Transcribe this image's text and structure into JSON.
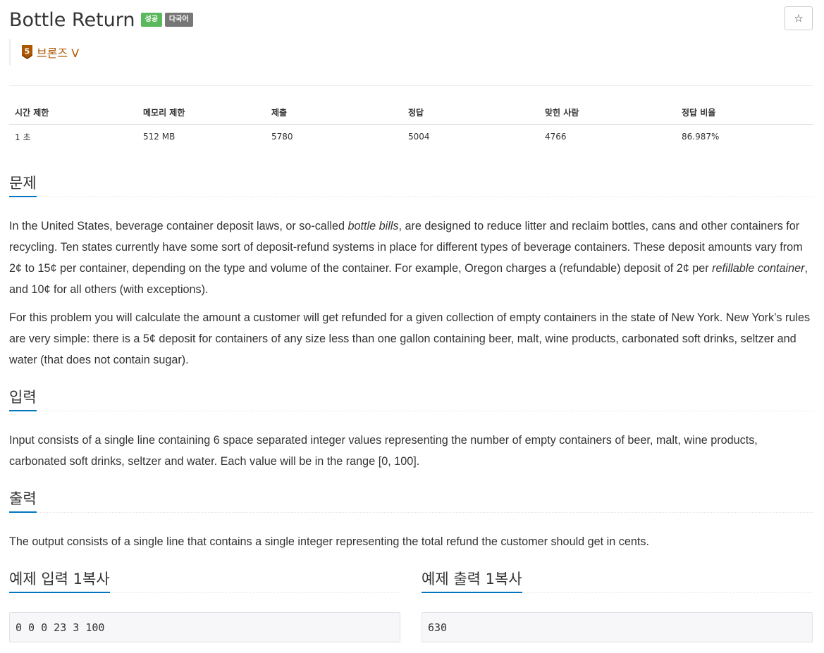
{
  "problem": {
    "title": "Bottle Return",
    "badges": {
      "success": "성공",
      "multilang": "다국어"
    },
    "star_icon": "☆",
    "tier": {
      "level": "5",
      "label": "브론즈 V",
      "color": "#ad5600"
    }
  },
  "stats": {
    "headers": [
      "시간 제한",
      "메모리 제한",
      "제출",
      "정답",
      "맞힌 사람",
      "정답 비율"
    ],
    "values": [
      "1 초",
      "512 MB",
      "5780",
      "5004",
      "4766",
      "86.987%"
    ]
  },
  "sections": {
    "description": {
      "heading": "문제",
      "p1_a": "In the United States, beverage container deposit laws, or so-called ",
      "p1_em1": "bottle bills",
      "p1_b": ", are designed to reduce litter and reclaim bottles, cans and other containers for recycling. Ten states currently have some sort of deposit-refund systems in place for different types of beverage containers. These deposit amounts vary from 2¢ to 15¢ per container, depending on the type and volume of the container. For example, Oregon charges a (refundable) deposit of 2¢ per ",
      "p1_em2": "refillable container",
      "p1_c": ", and 10¢ for all others (with exceptions).",
      "p2": "For this problem you will calculate the amount a customer will get refunded for a given collection of empty containers in the state of New York. New York’s rules are very simple: there is a 5¢ deposit for containers of any size less than one gallon containing beer, malt, wine products, carbonated soft drinks, seltzer and water (that does not contain sugar)."
    },
    "input": {
      "heading": "입력",
      "text": "Input consists of a single line containing 6 space separated integer values representing the number of empty containers of beer, malt, wine products, carbonated soft drinks, seltzer and water. Each value will be in the range [0, 100]."
    },
    "output": {
      "heading": "출력",
      "text": "The output consists of a single line that contains a single integer representing the total refund the customer should get in cents."
    },
    "sample_input": {
      "heading": "예제 입력 1",
      "copy": "복사",
      "value": "0 0 0 23 3 100"
    },
    "sample_output": {
      "heading": "예제 출력 1",
      "copy": "복사",
      "value": "630"
    }
  },
  "colors": {
    "accent": "#0076c0",
    "success_badge": "#5cb85c",
    "multilang_badge": "#777777"
  }
}
